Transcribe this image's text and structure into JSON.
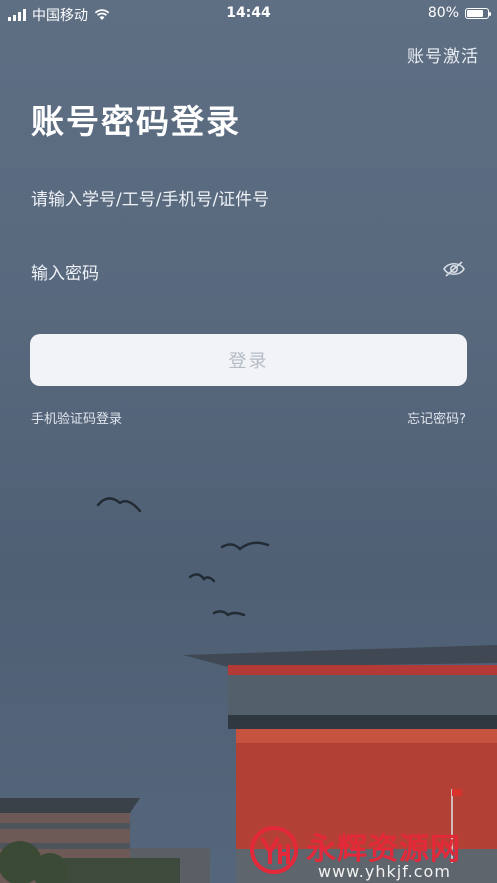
{
  "status_bar": {
    "carrier": "中国移动",
    "time": "14:44",
    "battery": "80%",
    "battery_level": 0.8
  },
  "header": {
    "activate_label": "账号激活"
  },
  "form": {
    "title": "账号密码登录",
    "account_placeholder": "请输入学号/工号/手机号/证件号",
    "password_placeholder": "输入密码",
    "login_label": "登录",
    "sms_login_label": "手机验证码登录",
    "forgot_label": "忘记密码?"
  },
  "watermark": {
    "name": "永辉资源网",
    "url": "www.yhkjf.com"
  },
  "icons": [
    "signal-icon",
    "wifi-icon",
    "battery-icon",
    "eye-off-icon"
  ],
  "colors": {
    "accent_red": "#e3283a",
    "button_bg": "#f1f3f6",
    "button_text": "#b5bcc6"
  }
}
